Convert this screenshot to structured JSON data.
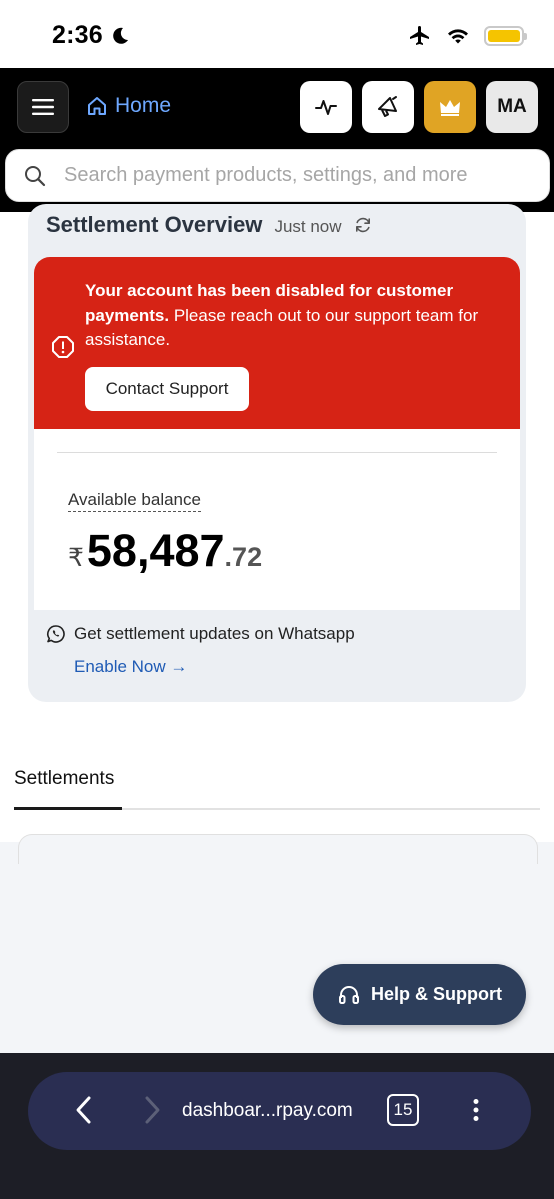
{
  "status_bar": {
    "time": "2:36",
    "icons": [
      "moon-icon",
      "airplane-icon",
      "wifi-icon",
      "battery-icon"
    ]
  },
  "header": {
    "menu_icon": "hamburger-icon",
    "home_label": "Home",
    "actions": [
      {
        "name": "activity-icon"
      },
      {
        "name": "megaphone-icon"
      },
      {
        "name": "crown-icon"
      },
      {
        "name": "avatar",
        "label": "MA"
      }
    ],
    "search_placeholder": "Search payment products, settings, and more"
  },
  "overview": {
    "title": "Settlement Overview",
    "updated": "Just now",
    "alert": {
      "bold": "Your account has been disabled for customer payments.",
      "text": " Please reach out to our support team for assistance.",
      "button": "Contact Support"
    },
    "balance": {
      "label": "Available balance",
      "currency": "₹",
      "integer": "58,487",
      "decimal": ".72"
    },
    "whatsapp": {
      "text": "Get settlement updates on Whatsapp",
      "link": "Enable Now",
      "link_arrow": "→"
    }
  },
  "tabs": {
    "active": "Settlements"
  },
  "help_button": {
    "label": "Help & Support"
  },
  "browser": {
    "url": "dashboar...rpay.com",
    "tab_count": "15"
  },
  "colors": {
    "alert_red": "#d62315",
    "gold": "#e0a424",
    "link_blue": "#1f5bb5",
    "help_navy": "#2d3e5b",
    "browser_bar": "#2a2e52"
  }
}
